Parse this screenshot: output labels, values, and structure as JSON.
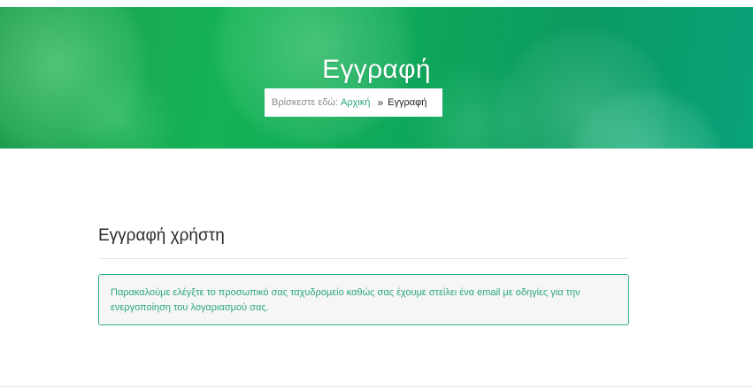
{
  "hero": {
    "title": "Εγγραφή",
    "breadcrumb": {
      "prefix": "Βρίσκεστε εδώ:",
      "home_label": "Αρχική",
      "separator": "»",
      "current": "Εγγραφή"
    }
  },
  "main": {
    "heading": "Εγγραφή χρήστη",
    "notice_text": "Παρακαλούμε ελέγξτε το προσωπικό σας ταχυδρομείο καθώς σας έχουμε στείλει ένα email με οδηγίες για την ενεργοποίηση του λογαριασμού σας."
  },
  "colors": {
    "accent": "#2aa876",
    "hero_green": "#15b257",
    "notice_border": "#2fb37a",
    "notice_bg": "#f6f6f6"
  }
}
